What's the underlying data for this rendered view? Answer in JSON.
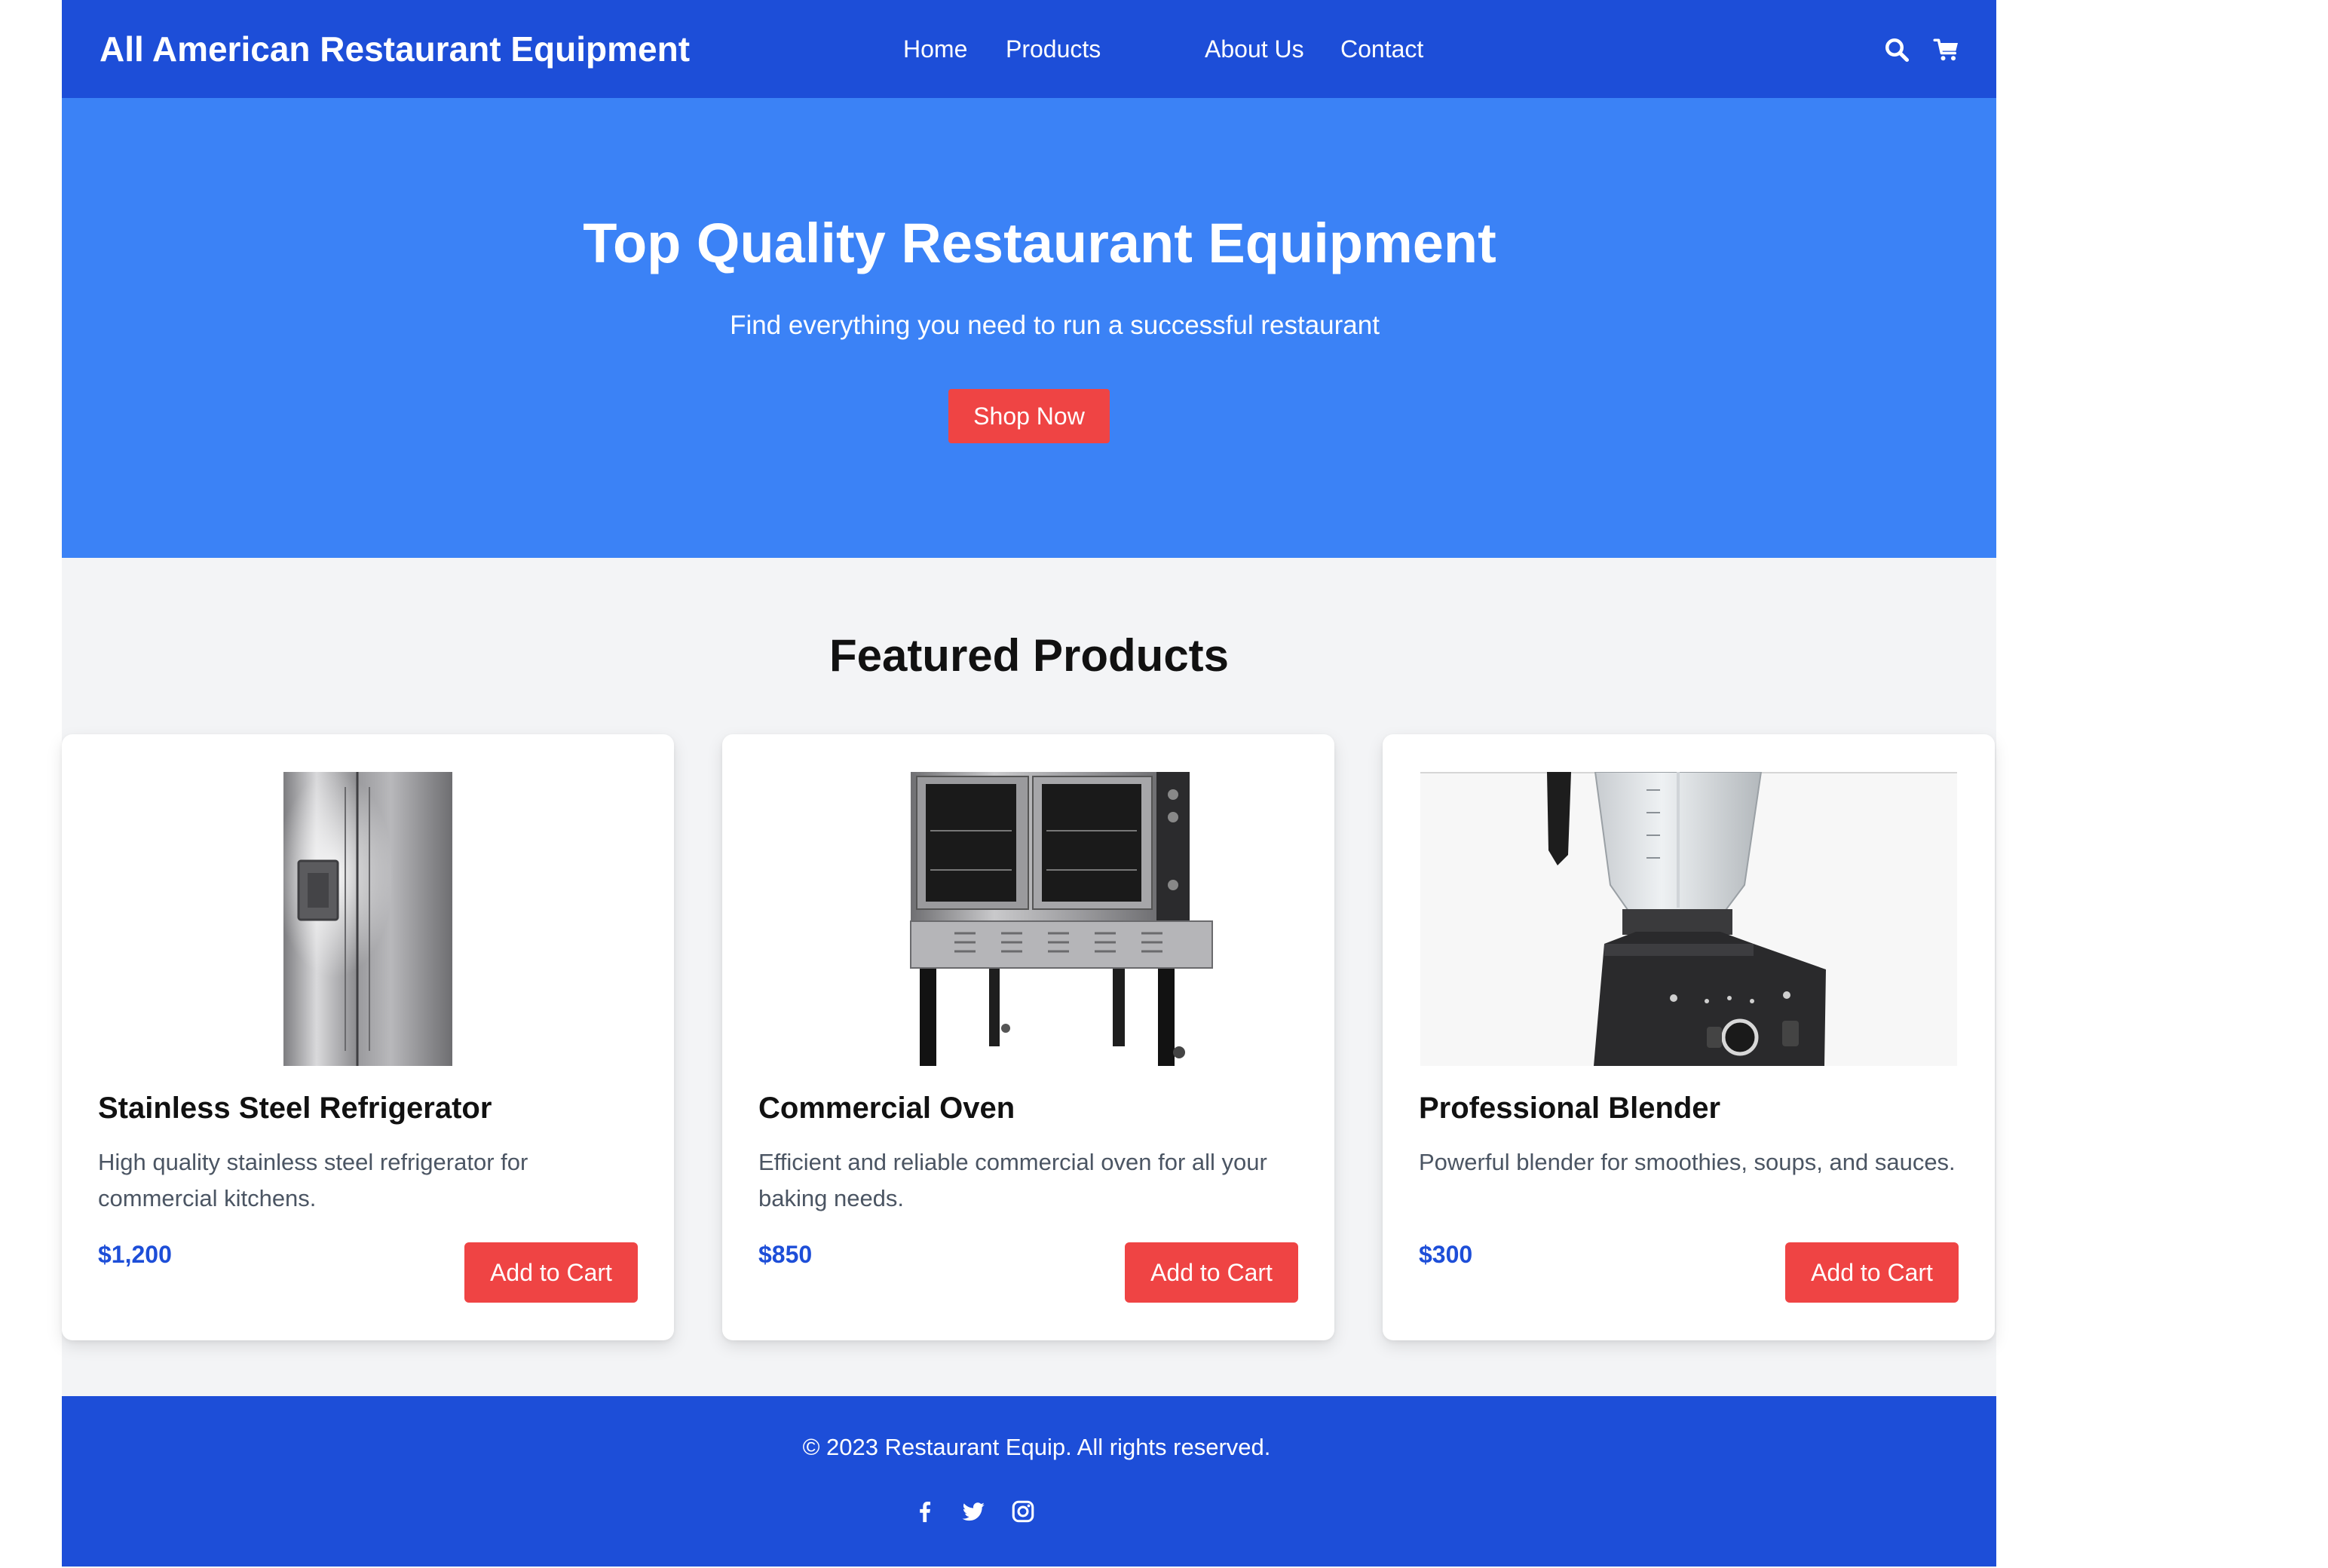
{
  "header": {
    "brand": "All American Restaurant Equipment",
    "nav": [
      {
        "label": "Home"
      },
      {
        "label": "Products"
      },
      {
        "label": "About Us"
      },
      {
        "label": "Contact"
      }
    ],
    "icons": [
      "search-icon",
      "cart-icon"
    ]
  },
  "hero": {
    "title": "Top Quality Restaurant Equipment",
    "subtitle": "Find everything you need to run a successful restaurant",
    "cta_label": "Shop Now"
  },
  "featured": {
    "title": "Featured Products",
    "products": [
      {
        "name": "Stainless Steel Refrigerator",
        "description": "High quality stainless steel refrigerator for commercial kitchens.",
        "price": "$1,200",
        "button_label": "Add to Cart",
        "image_icon": "refrigerator-image"
      },
      {
        "name": "Commercial Oven",
        "description": "Efficient and reliable commercial oven for all your baking needs.",
        "price": "$850",
        "button_label": "Add to Cart",
        "image_icon": "oven-image"
      },
      {
        "name": "Professional Blender",
        "description": "Powerful blender for smoothies, soups, and sauces.",
        "price": "$300",
        "button_label": "Add to Cart",
        "image_icon": "blender-image"
      }
    ]
  },
  "footer": {
    "copyright": "© 2023 Restaurant Equip. All rights reserved.",
    "social_icons": [
      "facebook-icon",
      "twitter-icon",
      "instagram-icon"
    ]
  },
  "colors": {
    "header_bg": "#1d4ed8",
    "hero_bg": "#3b82f6",
    "accent_red": "#ef4444",
    "price_blue": "#1d4ed8",
    "page_bg": "#f3f4f6"
  }
}
